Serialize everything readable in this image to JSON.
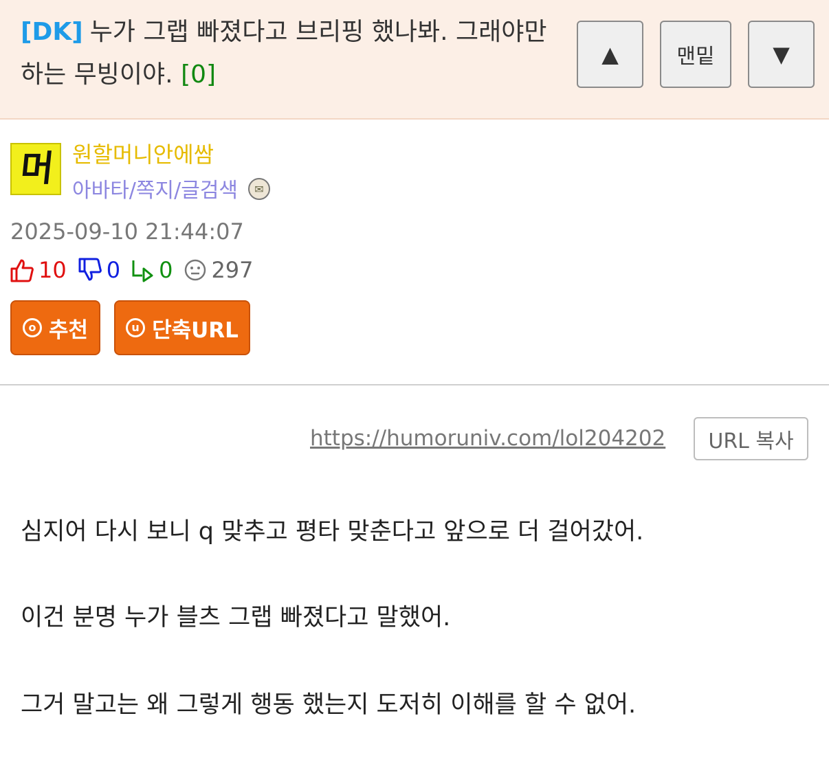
{
  "header": {
    "tag": "[DK]",
    "title": "누가 그랩 빠졌다고 브리핑 했나봐. 그래야만 하는 무빙이야.",
    "comment_count": "[0]",
    "nav": {
      "up": "▲",
      "bottom": "맨밑",
      "down": "▼"
    }
  },
  "author": {
    "avatar_text": "머",
    "name": "원할머니안에쌈",
    "links": "아바타/쪽지/글검색",
    "badge_icon": "level-badge-icon"
  },
  "post": {
    "date": "2025-09-10 21:44:07",
    "stats": {
      "upvotes": "10",
      "downvotes": "0",
      "replies": "0",
      "views": "297"
    },
    "buttons": {
      "recommend": "추천",
      "recommend_icon": "⓪",
      "short_url": "단축URL",
      "short_url_icon": "ⓤ"
    },
    "url": "https://humoruniv.com/lol204202",
    "copy_button": "URL 복사",
    "paragraphs": [
      "심지어 다시 보니 q 맞추고 평타 맞춘다고 앞으로 더 걸어갔어.",
      "이건 분명 누가 블츠 그랩 빠졌다고 말했어.",
      "그거 말고는 왜 그렇게 행동 했는지 도저히 이해를 할 수 없어."
    ]
  },
  "colors": {
    "header_bg": "#fcefe6",
    "tag": "#1e9be8",
    "comment_count": "#118811",
    "author_name": "#e6bb00",
    "author_links": "#8c86e0",
    "upvote": "#e01010",
    "downvote": "#1020e0",
    "reply": "#109010",
    "action_button": "#ee6a10"
  }
}
